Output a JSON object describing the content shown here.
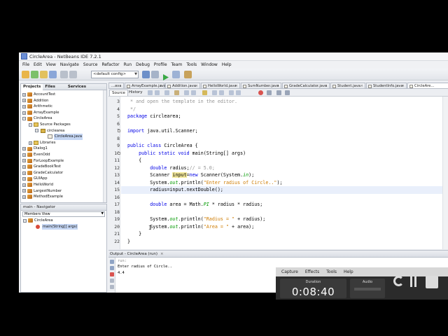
{
  "window": {
    "title": "CircleArea - NetBeans IDE 7.2.1"
  },
  "menu": [
    "File",
    "Edit",
    "View",
    "Navigate",
    "Source",
    "Refactor",
    "Run",
    "Debug",
    "Profile",
    "Team",
    "Tools",
    "Window",
    "Help"
  ],
  "toolbar": {
    "config": "<default config>"
  },
  "projects_panel": {
    "tabs": [
      "Projects",
      "Files",
      "Services"
    ],
    "items": [
      {
        "label": "AccountTest"
      },
      {
        "label": "Addition"
      },
      {
        "label": "Arithmetic"
      },
      {
        "label": "ArrayExample"
      },
      {
        "label": "CircleArea"
      },
      {
        "label": "Source Packages"
      },
      {
        "label": "circlearea"
      },
      {
        "label": "CircleArea.java"
      },
      {
        "label": "Libraries"
      },
      {
        "label": "Dialog1"
      },
      {
        "label": "EvenOdd"
      },
      {
        "label": "ForLoopExample"
      },
      {
        "label": "GradeBookTest"
      },
      {
        "label": "GradeCalculator"
      },
      {
        "label": "GUIApp"
      },
      {
        "label": "HelloWorld"
      },
      {
        "label": "LargestNumber"
      },
      {
        "label": "MethodExample"
      }
    ]
  },
  "navigator": {
    "title": "main - Navigator",
    "select": "Members View",
    "items": [
      "CircleArea",
      "main(String[] args)"
    ]
  },
  "editor_tabs": [
    "...ava",
    "ArrayExample.java",
    "Addition.java",
    "HelloWorld.java",
    "SumNumber.java",
    "GradeCalculator.java",
    "Student.java",
    "StudentInfo.java",
    "CircleAre..."
  ],
  "editor_toolbar": {
    "source": "Source",
    "history": "History"
  },
  "code_lines": [
    {
      "n": "3",
      "text": " * and open the template in the editor."
    },
    {
      "n": "4",
      "text": " */"
    },
    {
      "n": "5",
      "text": "package circlearea;"
    },
    {
      "n": "6",
      "text": ""
    },
    {
      "n": "7",
      "text": "import java.util.Scanner;"
    },
    {
      "n": "8",
      "text": ""
    },
    {
      "n": "9",
      "text": "public class CircleArea {"
    },
    {
      "n": "10",
      "text": "    public static void main(String[] args)"
    },
    {
      "n": "11",
      "text": "    {"
    },
    {
      "n": "12",
      "text": "        double radius;// = 5.0;"
    },
    {
      "n": "13",
      "text": "        Scanner input=new Scanner(System.in);"
    },
    {
      "n": "14",
      "text": "        System.out.println(\"Enter radius of Circle..\");"
    },
    {
      "n": "15",
      "text": "        radius=input.nextDouble();"
    },
    {
      "n": "16",
      "text": ""
    },
    {
      "n": "17",
      "text": "        double area = Math.PI * radius * radius;"
    },
    {
      "n": "18",
      "text": ""
    },
    {
      "n": "19",
      "text": "        System.out.println(\"Radius = \" + radius);"
    },
    {
      "n": "20",
      "text": "        System.out.println(\"Area = \" + area);"
    },
    {
      "n": "21",
      "text": "    }"
    },
    {
      "n": "22",
      "text": "}"
    }
  ],
  "output": {
    "title": "Output - CircleArea (run)",
    "lines": [
      "run:",
      "Enter radius of Circle..",
      "4.4"
    ]
  },
  "recorder": {
    "menu": [
      "Capture",
      "Effects",
      "Tools",
      "Help"
    ],
    "duration_label": "Duration",
    "duration": "0:08:40",
    "audio_label": "Audio"
  },
  "colors": {
    "keyword": "#0000e6",
    "comment": "#969696",
    "string": "#ce7b00",
    "static_field": "#009900",
    "highlight": "#f3e89a"
  }
}
